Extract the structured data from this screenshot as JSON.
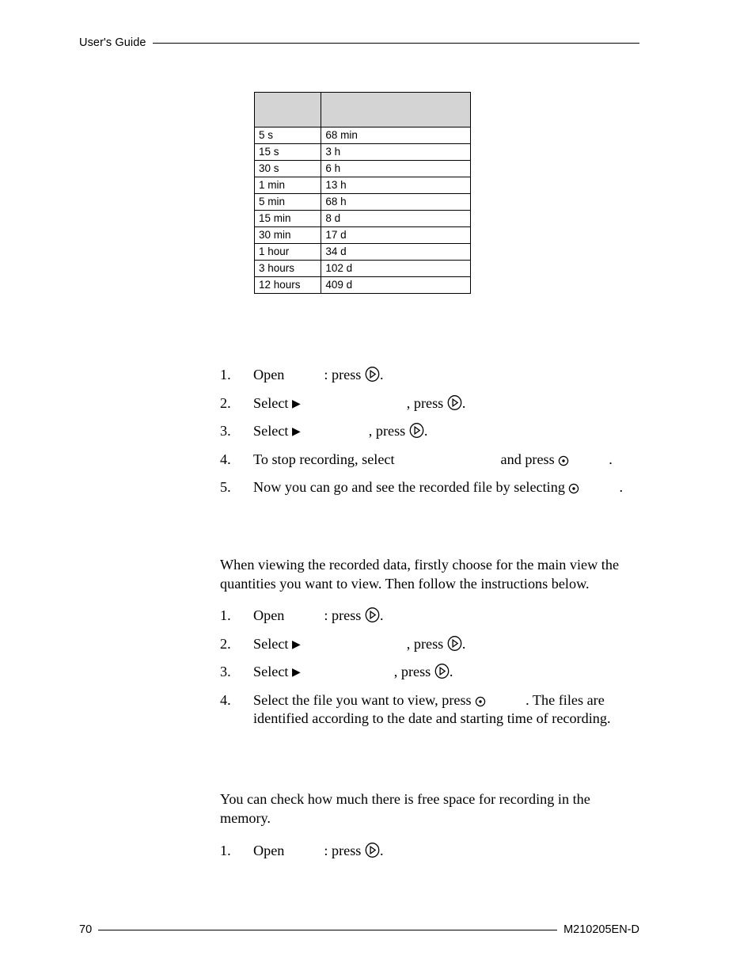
{
  "header": {
    "label": "User's Guide"
  },
  "table": {
    "headers": [
      "",
      ""
    ],
    "rows": [
      [
        "5 s",
        "68 min"
      ],
      [
        "15 s",
        "3 h"
      ],
      [
        "30 s",
        "6 h"
      ],
      [
        "1 min",
        "13 h"
      ],
      [
        "5 min",
        "68 h"
      ],
      [
        "15 min",
        "8 d"
      ],
      [
        "30 min",
        "17 d"
      ],
      [
        "1 hour",
        "34 d"
      ],
      [
        "3 hours",
        "102 d"
      ],
      [
        "12 hours",
        "409 d"
      ]
    ]
  },
  "sections": {
    "recording": {
      "heading": "",
      "steps": {
        "s1_num": "1.",
        "s1_a": "Open",
        "s1_b": ": press ",
        "s1_c": ".",
        "s2_num": "2.",
        "s2_a": "Select ",
        "s2_arrow": "▶",
        "s2_b": ", press ",
        "s2_c": ".",
        "s3_num": "3.",
        "s3_a": "Select ",
        "s3_arrow": "▶",
        "s3_b": ", press ",
        "s3_c": ".",
        "s4_num": "4.",
        "s4_a": "To stop recording, select",
        "s4_b": "and press ",
        "s4_c": ".",
        "s5_num": "5.",
        "s5_a": "Now you can go and see the recorded file by selecting ",
        "s5_b": "."
      }
    },
    "viewing": {
      "heading": "",
      "intro": "When viewing the recorded data, firstly choose for the main view the quantities you want to view. Then follow the instructions below.",
      "steps": {
        "s1_num": "1.",
        "s1_a": "Open",
        "s1_b": ": press ",
        "s1_c": ".",
        "s2_num": "2.",
        "s2_a": "Select ",
        "s2_arrow": "▶",
        "s2_b": ", press ",
        "s2_c": ".",
        "s3_num": "3.",
        "s3_a": "Select ",
        "s3_arrow": "▶",
        "s3_b": ", press ",
        "s3_c": ".",
        "s4_num": "4.",
        "s4_a": "Select the file you want to view, press ",
        "s4_b": ". The files are identified according to the date and starting time of recording."
      }
    },
    "memory": {
      "heading": "",
      "intro": "You can check how much there is free space for recording in the memory.",
      "steps": {
        "s1_num": "1.",
        "s1_a": "Open",
        "s1_b": ": press ",
        "s1_c": "."
      }
    }
  },
  "icons": {
    "play": "play-key-icon",
    "dot": "select-key-icon"
  },
  "footer": {
    "page_number": "70",
    "document_code": "M210205EN-D"
  }
}
